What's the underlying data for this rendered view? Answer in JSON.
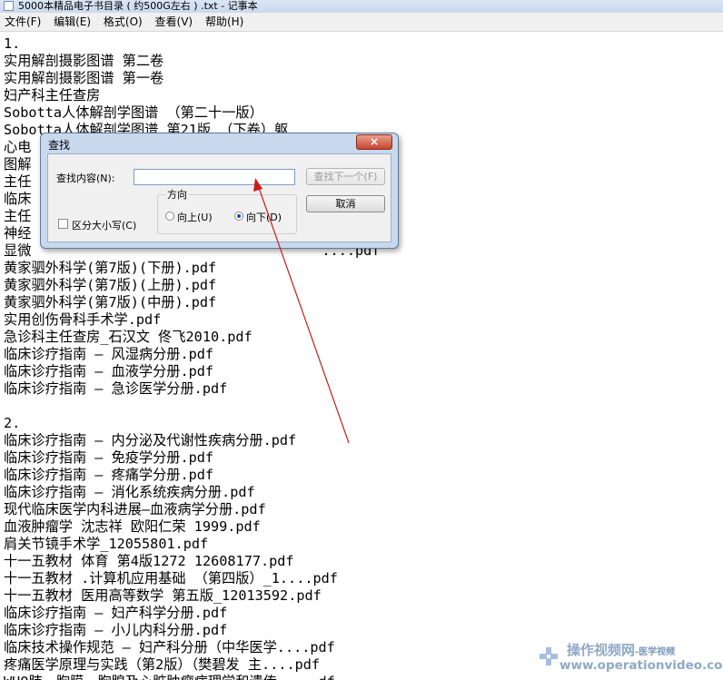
{
  "window": {
    "title": "5000本精品电子书目录 ( 约500G左右 ) .txt - 记事本",
    "accent": "#c9d9ee"
  },
  "menubar": [
    "文件(F)",
    "编辑(E)",
    "格式(O)",
    "查看(V)",
    "帮助(H)"
  ],
  "editor": {
    "lines": [
      "1.",
      "实用解剖摄影图谱 第二卷",
      "实用解剖摄影图谱 第一卷",
      "妇产科主任查房",
      "Sobotta人体解剖学图谱 （第二十一版）",
      "Sobotta人体解剖学图谱 第21版 （下卷）躯",
      "心电",
      "图解",
      "主任                                         df",
      "临床",
      "主任",
      "神经",
      "显微                                   ....pdf",
      "黄家驷外科学(第7版)(下册).pdf",
      "黄家驷外科学(第7版)(上册).pdf",
      "黄家驷外科学(第7版)(中册).pdf",
      "实用创伤骨科手术学.pdf",
      "急诊科主任查房_石汉文 佟飞2010.pdf",
      "临床诊疗指南 — 风湿病分册.pdf",
      "临床诊疗指南 — 血液学分册.pdf",
      "临床诊疗指南 — 急诊医学分册.pdf",
      "",
      "2.",
      "临床诊疗指南 — 内分泌及代谢性疾病分册.pdf",
      "临床诊疗指南 — 免疫学分册.pdf",
      "临床诊疗指南 — 疼痛学分册.pdf",
      "临床诊疗指南 — 消化系统疾病分册.pdf",
      "现代临床医学内科进展—血液病学分册.pdf",
      "血液肿瘤学 沈志祥 欧阳仁荣 1999.pdf",
      "肩关节镜手术学_12055801.pdf",
      "十一五教材 体育 第4版1272 12608177.pdf",
      "十一五教材 .计算机应用基础 （第四版）_1....pdf",
      "十一五教材 医用高等数学 第五版_12013592.pdf",
      "临床诊疗指南 — 妇产科学分册.pdf",
      "临床诊疗指南 — 小儿内科分册.pdf",
      "临床技术操作规范 — 妇产科分册（中华医学....pdf",
      "疼痛医学原理与实践（第2版）（樊碧发 主....pdf",
      "WHO肺、胸膜、胸腺及心脏肿瘤病理学和遗传.....df"
    ]
  },
  "find_dialog": {
    "title": "查找",
    "close_label": "×",
    "find_label": "查找内容(N):",
    "find_value": "",
    "find_next_label": "查找下一个(F)",
    "cancel_label": "取消",
    "direction_label": "方向",
    "up_label": "向上(U)",
    "down_label": "向下(D)",
    "match_case_label": "区分大小写(C)",
    "selected_direction": "down",
    "match_case_checked": false
  },
  "annotation": {
    "color": "#cc1a1a"
  },
  "watermark": {
    "brand": "操作视频网",
    "suffix": "-医学视频",
    "url": "www.operationvideo.com"
  }
}
